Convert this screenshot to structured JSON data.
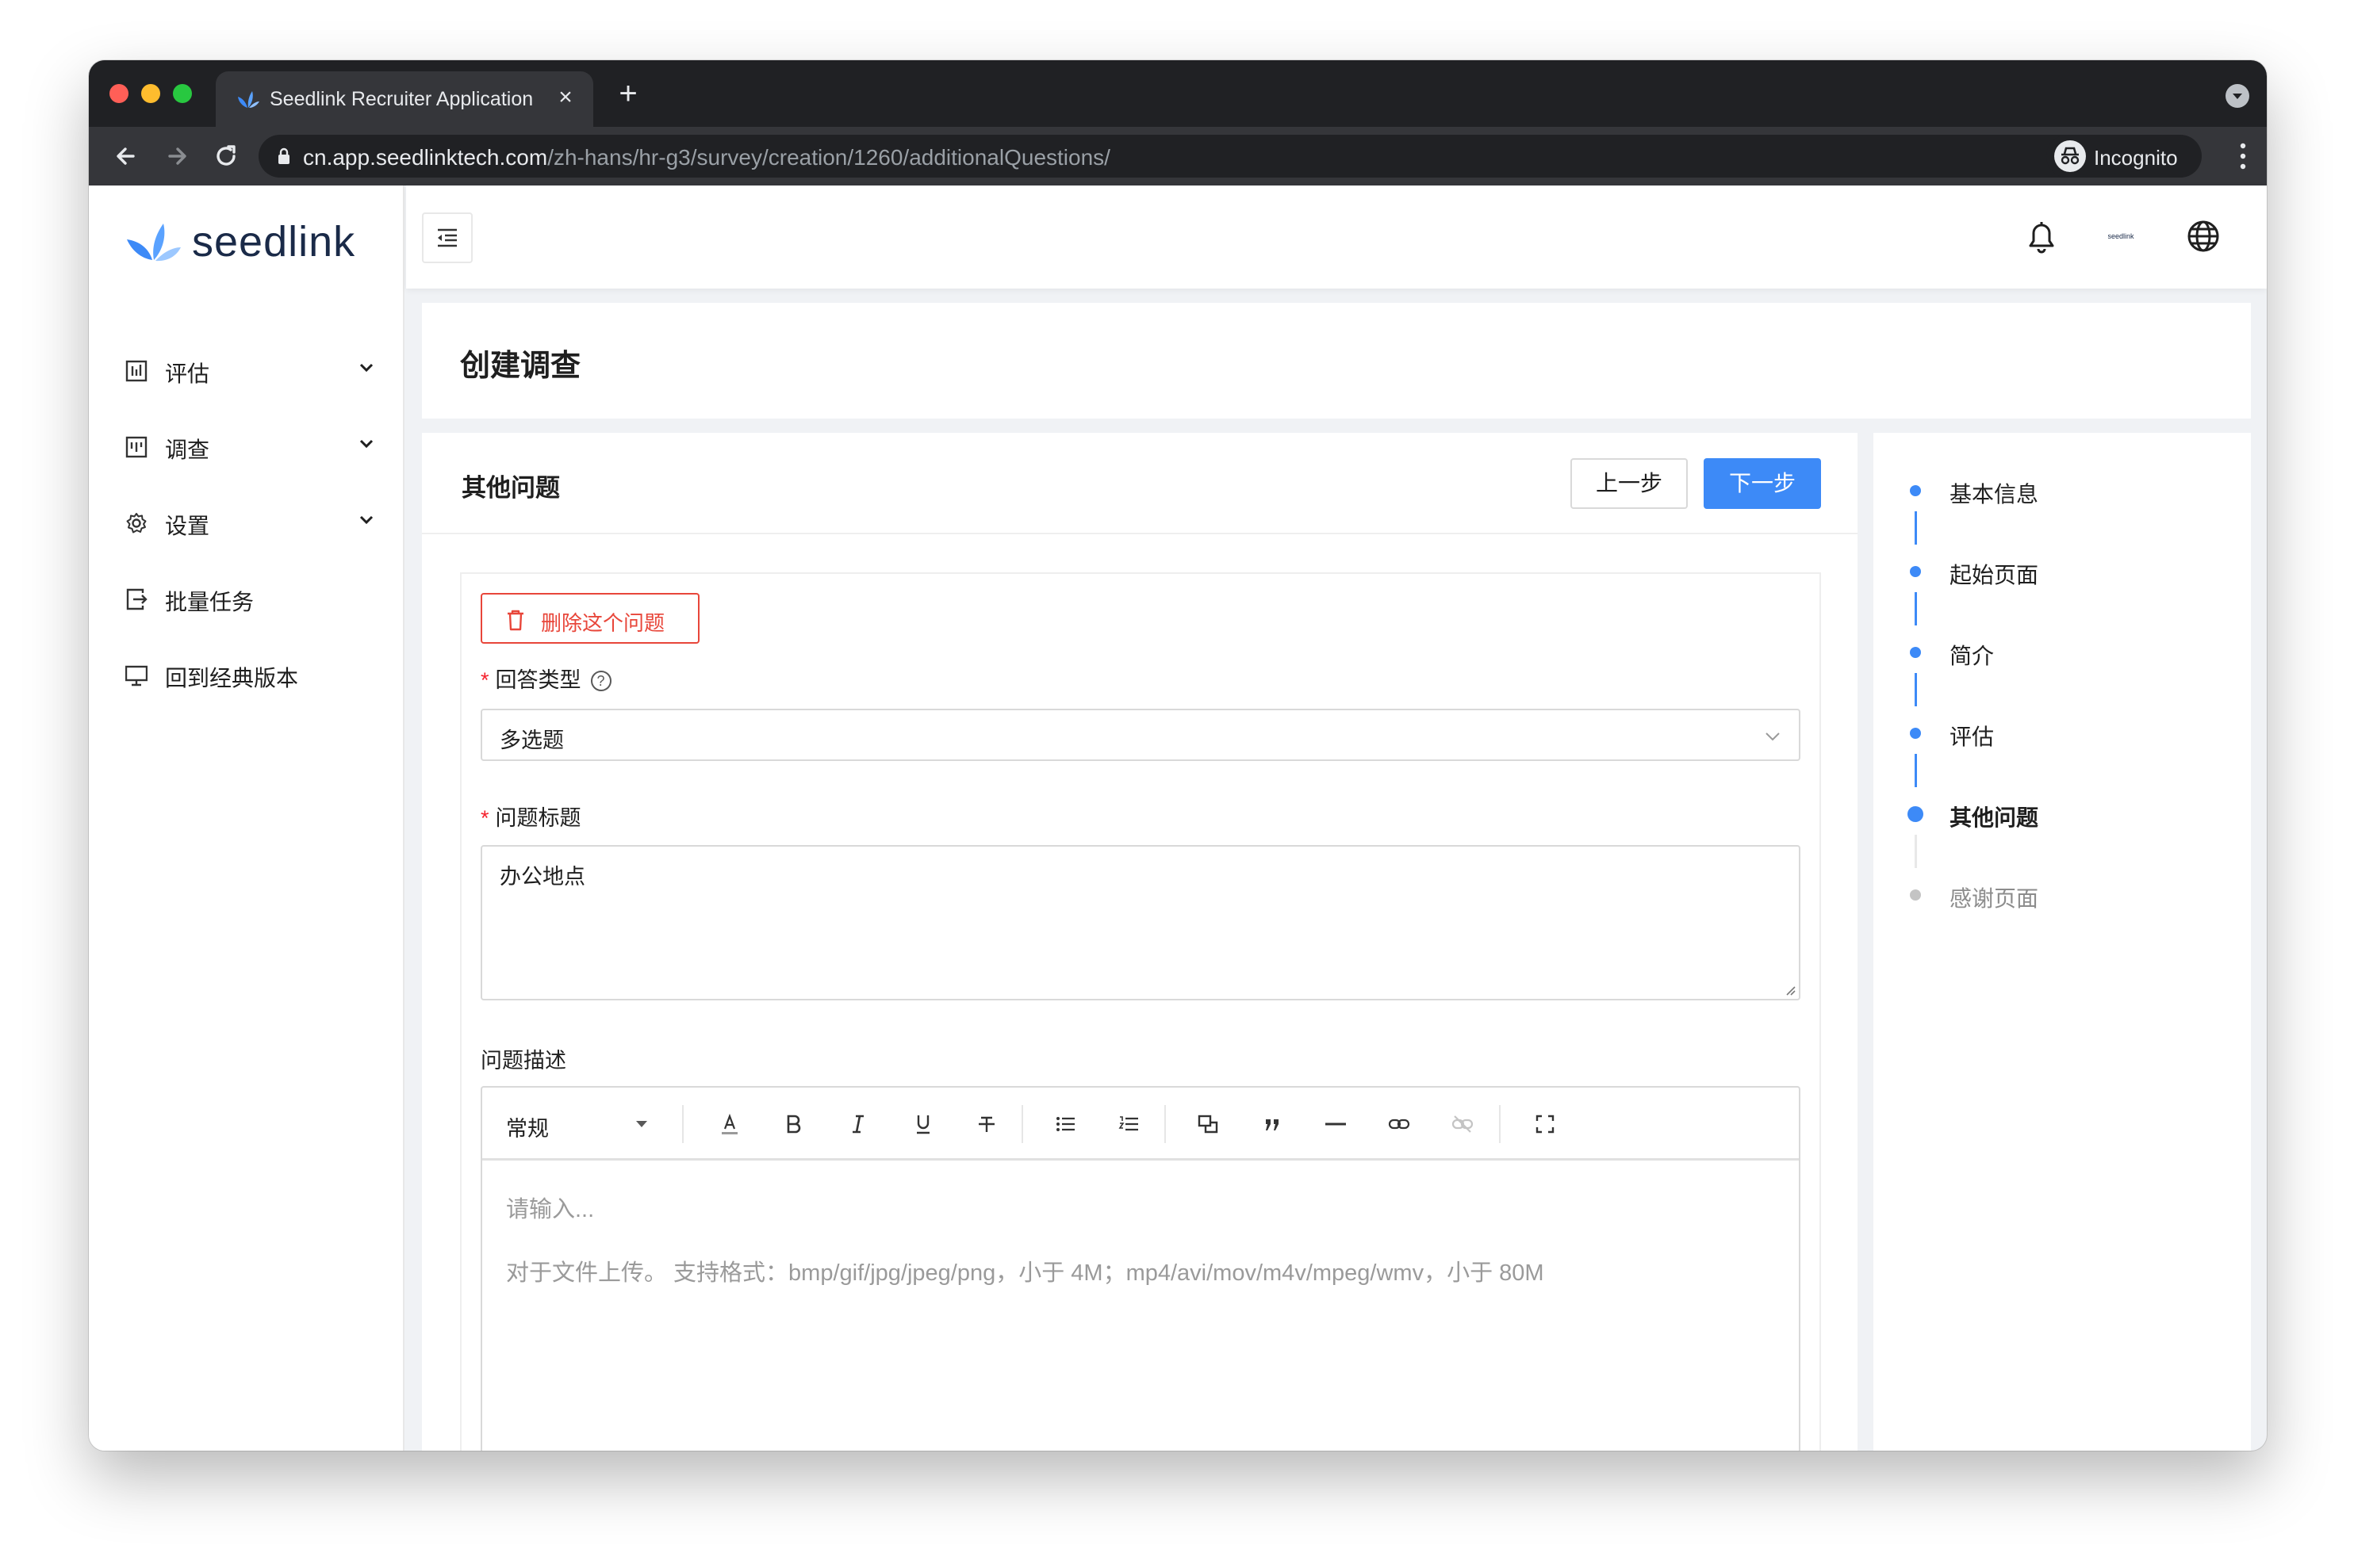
{
  "browser": {
    "tab_title": "Seedlink Recruiter Application",
    "url_host": "cn.app.seedlinktech.com",
    "url_path": "/zh-hans/hr-g3/survey/creation/1260/additionalQuestions/",
    "incognito_label": "Incognito",
    "close_glyph": "×",
    "new_tab_glyph": "+"
  },
  "sidebar": {
    "logo_text": "seedlink",
    "items": [
      {
        "label": "评估",
        "icon": "assessment-icon",
        "expandable": true
      },
      {
        "label": "调查",
        "icon": "survey-icon",
        "expandable": true
      },
      {
        "label": "设置",
        "icon": "gear-icon",
        "expandable": true
      },
      {
        "label": "批量任务",
        "icon": "batch-task-icon",
        "expandable": false
      },
      {
        "label": "回到经典版本",
        "icon": "monitor-icon",
        "expandable": false
      }
    ]
  },
  "header": {
    "mini_logo_text": "seedlink"
  },
  "page": {
    "title": "创建调查"
  },
  "card": {
    "title": "其他问题",
    "prev_label": "上一步",
    "next_label": "下一步"
  },
  "question": {
    "delete_label": "删除这个问题",
    "answer_type_label": "回答类型",
    "answer_type_value": "多选题",
    "title_label": "问题标题",
    "title_value": "办公地点",
    "description_label": "问题描述",
    "required_mark": "*",
    "help_glyph": "?"
  },
  "editor": {
    "style_value": "常规",
    "placeholder": "请输入...",
    "upload_hint": "对于文件上传。 支持格式：bmp/gif/jpg/jpeg/png，小于 4M；mp4/avi/mov/m4v/mpeg/wmv，小于 80M",
    "toolbar": [
      "font-color-icon",
      "bold-icon",
      "italic-icon",
      "underline-icon",
      "strikethrough-icon",
      "bullet-list-icon",
      "numbered-list-icon",
      "media-icon",
      "quote-icon",
      "horizontal-rule-icon",
      "link-icon",
      "unlink-icon",
      "fullscreen-icon"
    ]
  },
  "steps": [
    {
      "label": "基本信息",
      "status": "done"
    },
    {
      "label": "起始页面",
      "status": "done"
    },
    {
      "label": "简介",
      "status": "done"
    },
    {
      "label": "评估",
      "status": "done"
    },
    {
      "label": "其他问题",
      "status": "current"
    },
    {
      "label": "感谢页面",
      "status": "pending"
    }
  ],
  "colors": {
    "primary": "#3d8af7",
    "danger": "#e8463a",
    "logo_blue": "#3d8af7",
    "logo_navy": "#1a2a48"
  }
}
